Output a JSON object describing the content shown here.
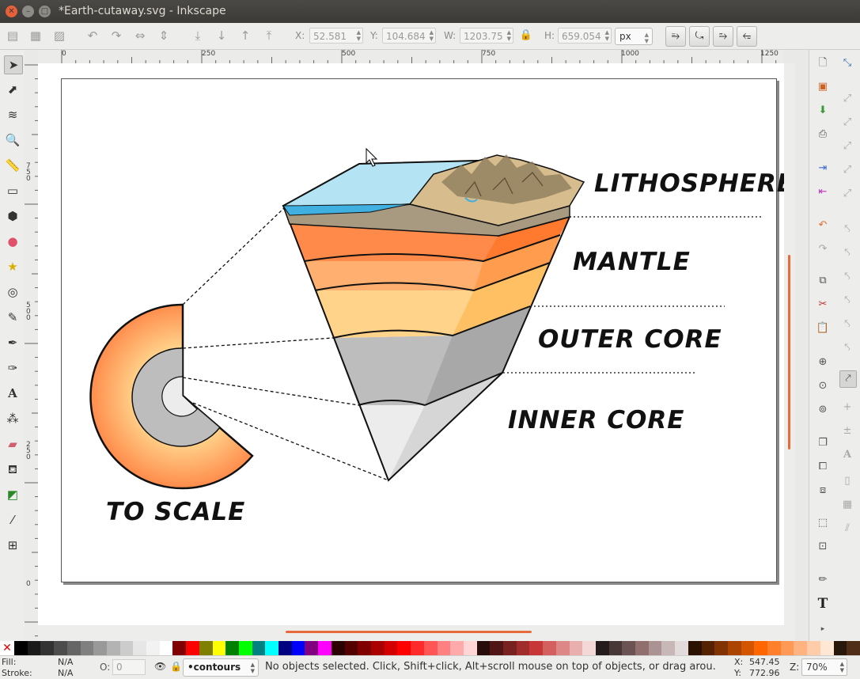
{
  "window": {
    "title": "*Earth-cutaway.svg - Inkscape"
  },
  "toolbar": {
    "x_label": "X:",
    "x_value": "52.581",
    "y_label": "Y:",
    "y_value": "104.684",
    "w_label": "W:",
    "w_value": "1203.75",
    "h_label": "H:",
    "h_value": "659.054",
    "units": "px"
  },
  "ruler": {
    "h_ticks": [
      "0",
      "250",
      "500",
      "750",
      "1000",
      "1250"
    ],
    "v_ticks": [
      "750",
      "500",
      "250",
      "0"
    ]
  },
  "drawing": {
    "labels": {
      "lithosphere": "LITHOSPHERE",
      "mantle": "MANTLE",
      "outer_core": "OUTER CORE",
      "inner_core": "INNER CORE",
      "to_scale": "TO SCALE"
    },
    "colors": {
      "ocean": "#b4e4f4",
      "mantle_upper": "#ff8a4a",
      "mantle_mid": "#ffb070",
      "mantle_low": "#ffd38a",
      "outer_core": "#bdbdbd",
      "inner_core": "#ececec",
      "crust": "#a89a80"
    }
  },
  "statusbar": {
    "fill_label": "Fill:",
    "fill_value": "N/A",
    "stroke_label": "Stroke:",
    "stroke_value": "N/A",
    "opacity_label": "O:",
    "opacity_value": "0",
    "layer": "•contours",
    "message": "No objects selected. Click, Shift+click, Alt+scroll mouse on top of objects, or drag arou.",
    "cursor_x_label": "X:",
    "cursor_x": "547.45",
    "cursor_y_label": "Y:",
    "cursor_y": "772.96",
    "zoom_label": "Z:",
    "zoom": "70%"
  },
  "palette": [
    "#000000",
    "#1a1a1a",
    "#333333",
    "#4d4d4d",
    "#666666",
    "#808080",
    "#999999",
    "#b3b3b3",
    "#cccccc",
    "#e6e6e6",
    "#f2f2f2",
    "#ffffff",
    "#800000",
    "#ff0000",
    "#808000",
    "#ffff00",
    "#008000",
    "#00ff00",
    "#008080",
    "#00ffff",
    "#000080",
    "#0000ff",
    "#800080",
    "#ff00ff",
    "#2b0000",
    "#550000",
    "#800000",
    "#aa0000",
    "#d40000",
    "#ff0000",
    "#ff2a2a",
    "#ff5555",
    "#ff8080",
    "#ffaaaa",
    "#ffd5d5",
    "#280b0b",
    "#501616",
    "#782121",
    "#a02c2c",
    "#c83737",
    "#d35f5f",
    "#de8787",
    "#e9afaf",
    "#f4d7d7",
    "#241c1c",
    "#483737",
    "#6c5353",
    "#916f6f",
    "#ac9393",
    "#c8b7b7",
    "#e3dbdb",
    "#2b1100",
    "#552200",
    "#803300",
    "#aa4400",
    "#d45500",
    "#ff6600",
    "#ff7f2a",
    "#ff9955",
    "#ffb380",
    "#ffccaa",
    "#ffe6d5",
    "#28170b",
    "#502d16"
  ]
}
